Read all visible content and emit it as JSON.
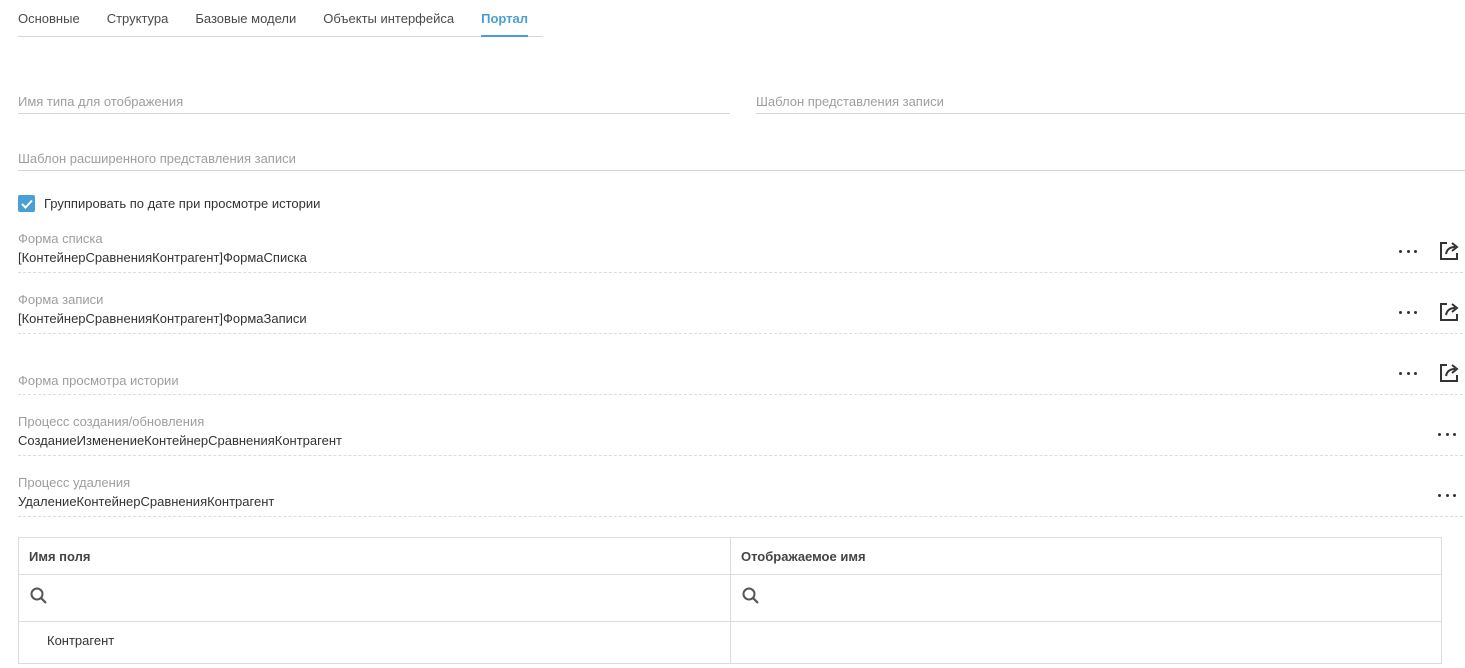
{
  "tabs": [
    {
      "label": "Основные"
    },
    {
      "label": "Структура"
    },
    {
      "label": "Базовые модели"
    },
    {
      "label": "Объекты интерфейса"
    },
    {
      "label": "Портал",
      "active": true
    }
  ],
  "fields": {
    "display_type_name": {
      "placeholder": "Имя типа для отображения"
    },
    "record_template": {
      "placeholder": "Шаблон представления записи"
    },
    "extended_record_template": {
      "placeholder": "Шаблон расширенного представления записи"
    }
  },
  "group_by_date": {
    "label": "Группировать по дате при просмотре истории",
    "checked": true
  },
  "refs": {
    "list_form": {
      "label": "Форма списка",
      "value": "[КонтейнерСравненияКонтрагент]ФормаСписка"
    },
    "record_form": {
      "label": "Форма записи",
      "value": "[КонтейнерСравненияКонтрагент]ФормаЗаписи"
    },
    "history_form": {
      "label": "Форма просмотра истории",
      "value": ""
    },
    "create_update_process": {
      "label": "Процесс создания/обновления",
      "value": "СозданиеИзменениеКонтейнерСравненияКонтрагент"
    },
    "delete_process": {
      "label": "Процесс удаления",
      "value": "УдалениеКонтейнерСравненияКонтрагент"
    }
  },
  "grid": {
    "columns": [
      "Имя поля",
      "Отображаемое имя"
    ],
    "rows": [
      [
        "Контрагент",
        ""
      ]
    ]
  },
  "colors": {
    "accent": "#4a9fd4",
    "border": "#d6d6d6",
    "muted": "#9e9e9e"
  },
  "icons": [
    "more-dots-icon",
    "open-external-icon",
    "search-icon",
    "checkmark-icon"
  ]
}
